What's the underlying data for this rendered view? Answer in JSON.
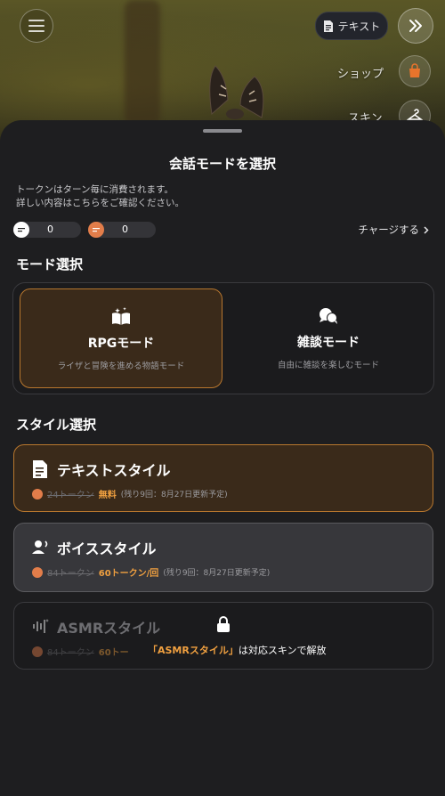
{
  "topbar": {
    "text_pill_label": "テキスト"
  },
  "side_menu": {
    "shop_label": "ショップ",
    "skin_label": "スキン"
  },
  "sheet": {
    "title": "会話モードを選択",
    "note_line1": "トークンはターン毎に消費されます。",
    "note_line2": "詳しい内容はこちらをご確認ください。",
    "token_a_value": "0",
    "token_b_value": "0",
    "charge_label": "チャージする",
    "mode_section": "モード選択",
    "modes": [
      {
        "name": "RPGモード",
        "desc": "ライザと冒険を進める物語モード",
        "selected": true
      },
      {
        "name": "雑談モード",
        "desc": "自由に雑談を楽しむモード",
        "selected": false
      }
    ],
    "style_section": "スタイル選択",
    "styles": [
      {
        "name": "テキストスタイル",
        "old_price": "24トークン",
        "new_price": "無料",
        "remaining": "(残り9回：8月27日更新予定)"
      },
      {
        "name": "ボイススタイル",
        "old_price": "84トークン",
        "new_price": "60トークン/回",
        "remaining": "(残り9回：8月27日更新予定)"
      },
      {
        "name": "ASMRスタイル",
        "old_price": "84トークン",
        "new_price": "60トー",
        "lock_highlight": "「ASMRスタイル」",
        "lock_rest": "は対応スキンで解放"
      }
    ]
  },
  "colors": {
    "accent": "#f0a040",
    "selected_border": "#b8772e",
    "coin": "#e27d4a",
    "sheet_bg": "#1e1e20"
  }
}
